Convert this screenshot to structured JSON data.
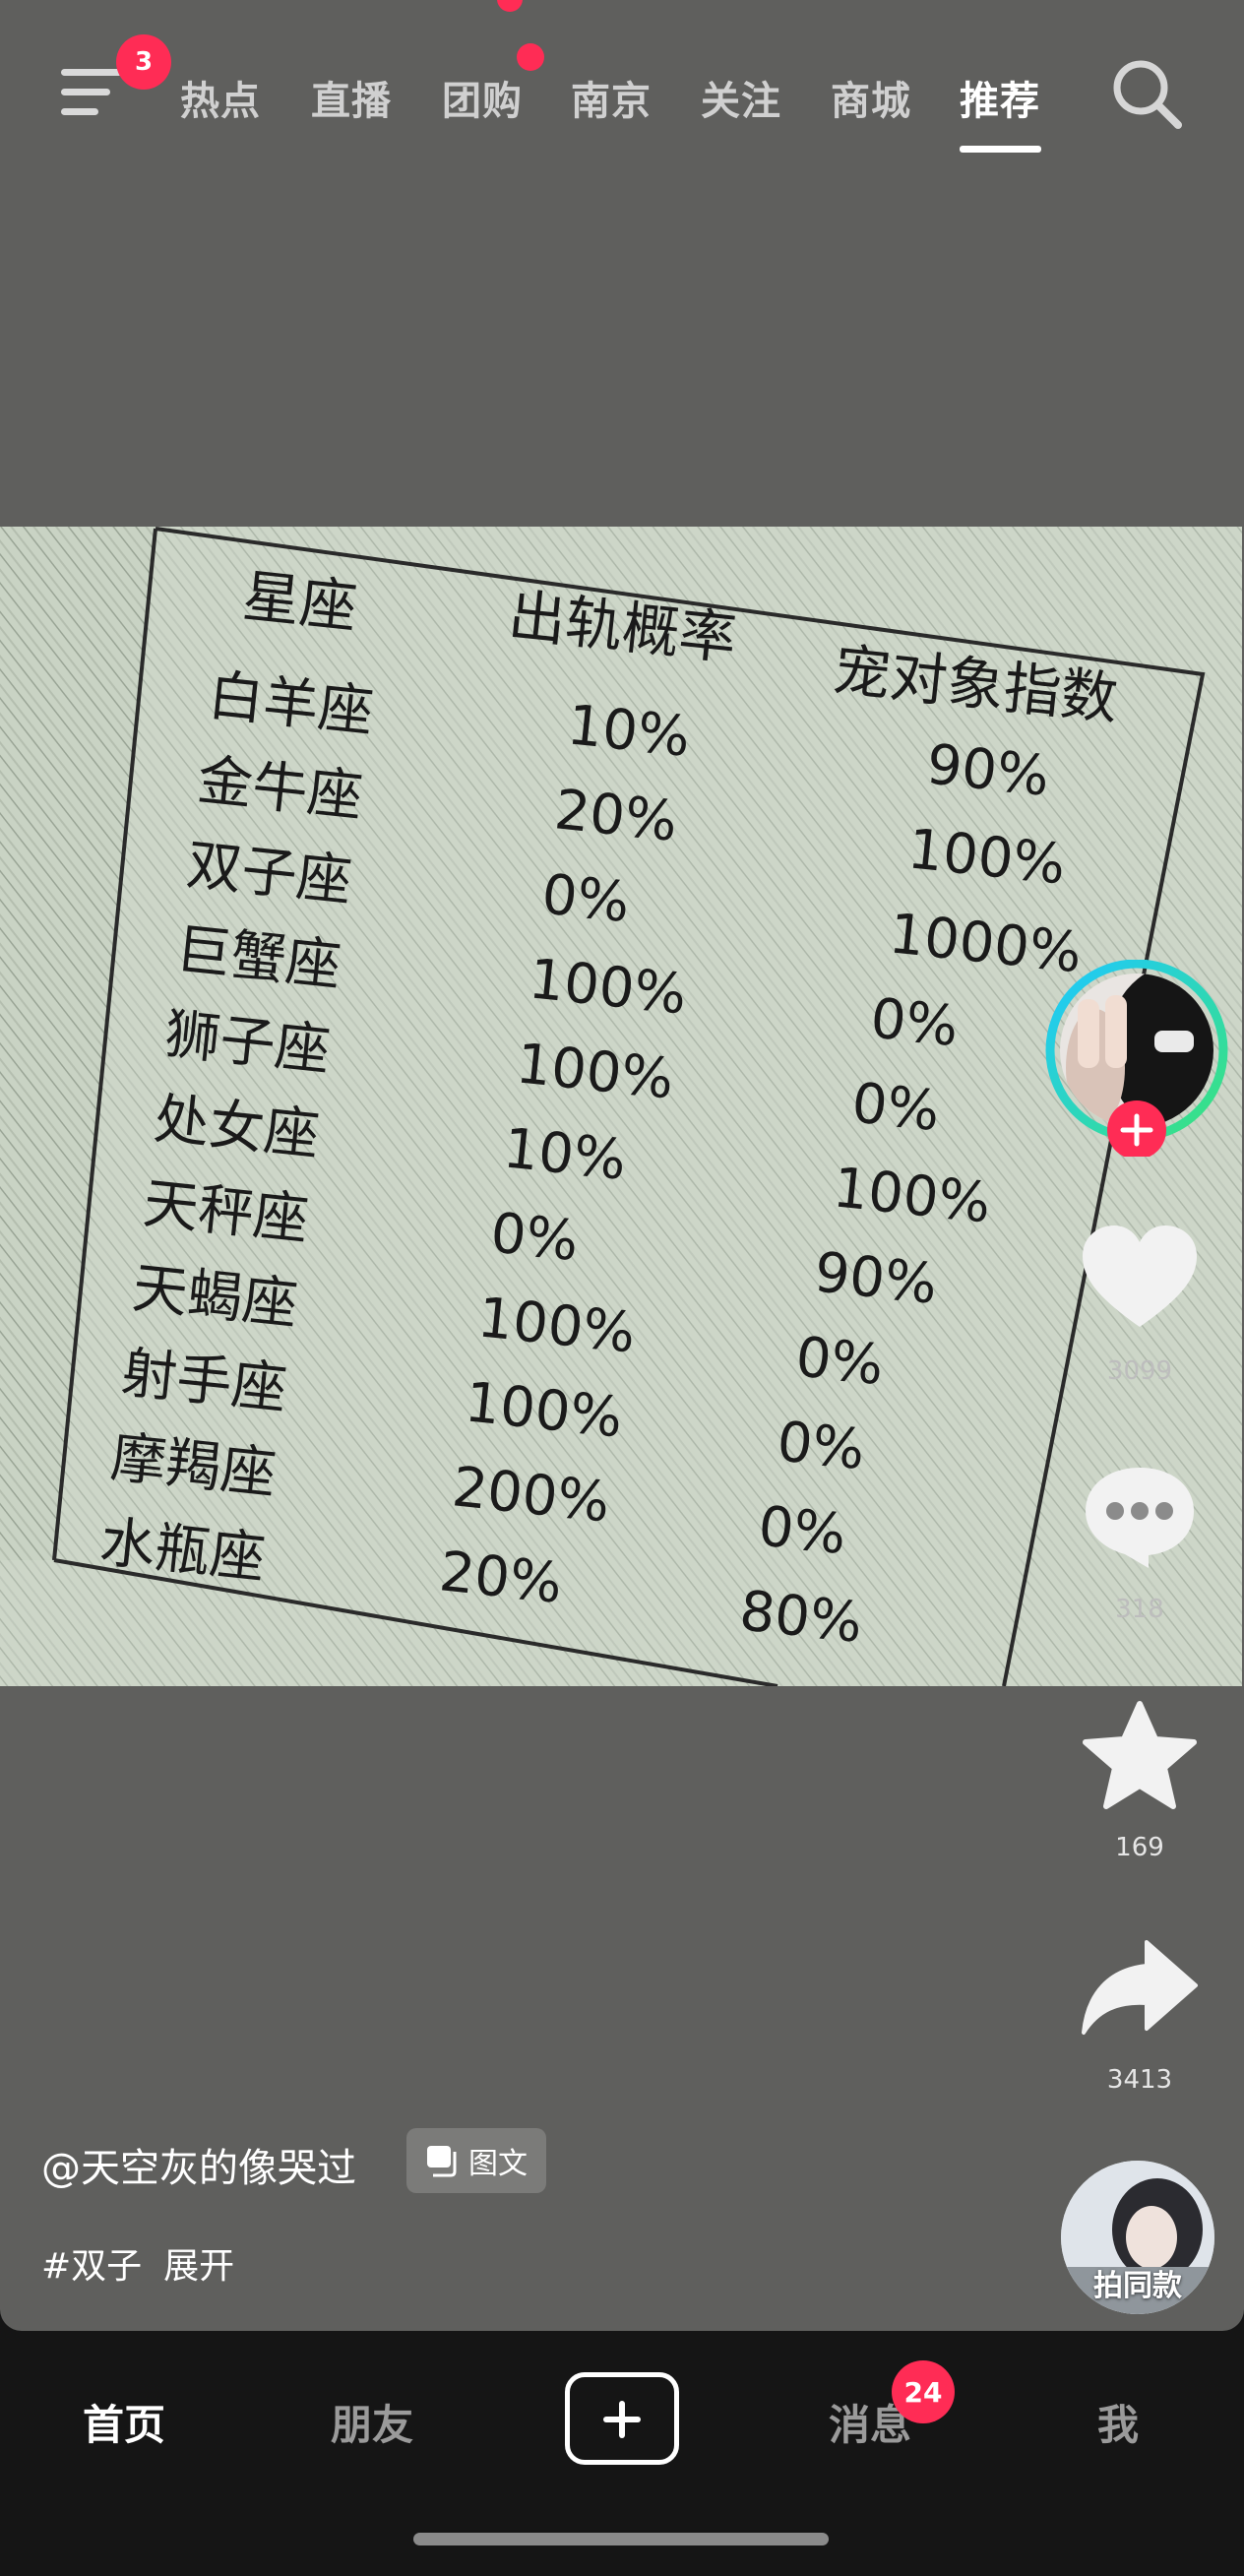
{
  "top_nav": {
    "menu_badge": "3",
    "tabs": [
      "热点",
      "直播",
      "团购",
      "南京",
      "关注",
      "商城",
      "推荐"
    ],
    "active_tab": "推荐"
  },
  "post": {
    "table": {
      "headers": [
        "星座",
        "出轨概率",
        "宠对象指数"
      ],
      "rows": [
        [
          "白羊座",
          "10%",
          "90%"
        ],
        [
          "金牛座",
          "20%",
          "100%"
        ],
        [
          "双子座",
          "0%",
          "1000%"
        ],
        [
          "巨蟹座",
          "100%",
          "0%"
        ],
        [
          "狮子座",
          "100%",
          "0%"
        ],
        [
          "处女座",
          "10%",
          "100%"
        ],
        [
          "天秤座",
          "0%",
          "90%"
        ],
        [
          "天蝎座",
          "100%",
          "0%"
        ],
        [
          "射手座",
          "100%",
          "0%"
        ],
        [
          "摩羯座",
          "200%",
          "0%"
        ],
        [
          "水瓶座",
          "20%",
          "80%"
        ]
      ]
    }
  },
  "actions": {
    "likes": "3099",
    "comments": "318",
    "favorites": "169",
    "shares": "3413"
  },
  "caption": {
    "author": "@天空灰的像哭过",
    "type_label": "图文",
    "hashtag": "#双子",
    "expand_label": "展开",
    "same_style_label": "拍同款"
  },
  "bottom_nav": {
    "home": "首页",
    "friends": "朋友",
    "messages": "消息",
    "messages_badge": "24",
    "me": "我"
  },
  "colors": {
    "accent": "#ff2c55",
    "feed_bg": "#5f5f5d",
    "paper": "#c9d3c4",
    "ink": "#1a1a1a"
  }
}
